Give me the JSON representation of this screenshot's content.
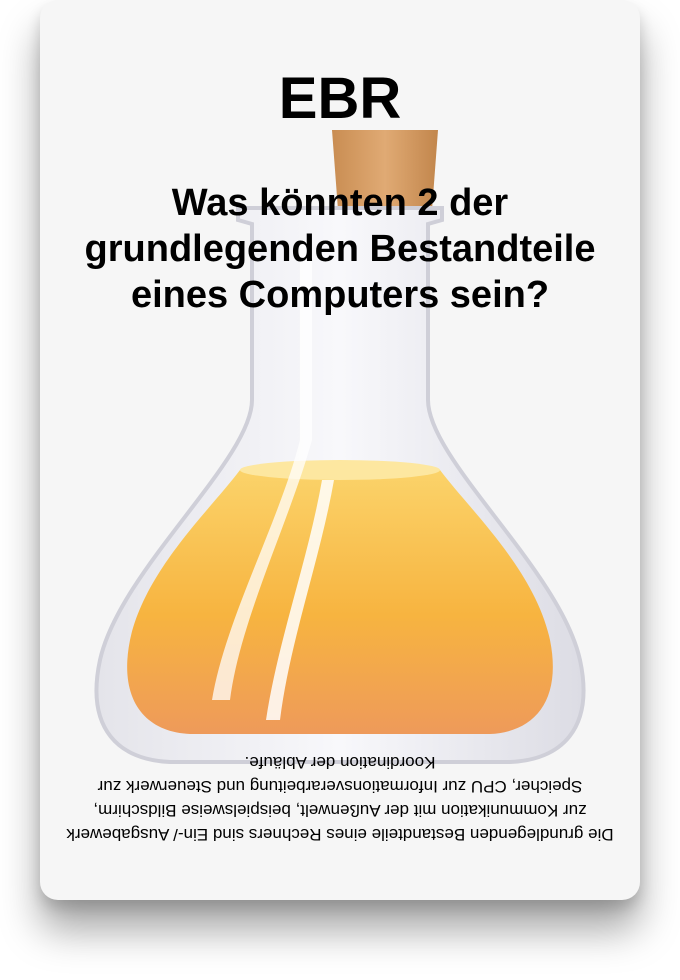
{
  "card": {
    "deck_label": "EBR",
    "question": "Was könnten 2 der grundlegenden Bestandteile eines Computers sein?",
    "answer": "Die grundlegenden Bestandteile eines Rechners sind Ein-/ Ausgabewerk zur Kommunikation mit der Außenwelt, beispielsweise Bildschirm, Speicher, CPU zur Informationsverarbeitung und Steuerwerk zur Koordination der Abläufe.",
    "illustration_icon": "flask-icon",
    "colors": {
      "card_background": "#f6f6f6",
      "liquid": "#f5a623",
      "cork": "#d9a066"
    }
  }
}
